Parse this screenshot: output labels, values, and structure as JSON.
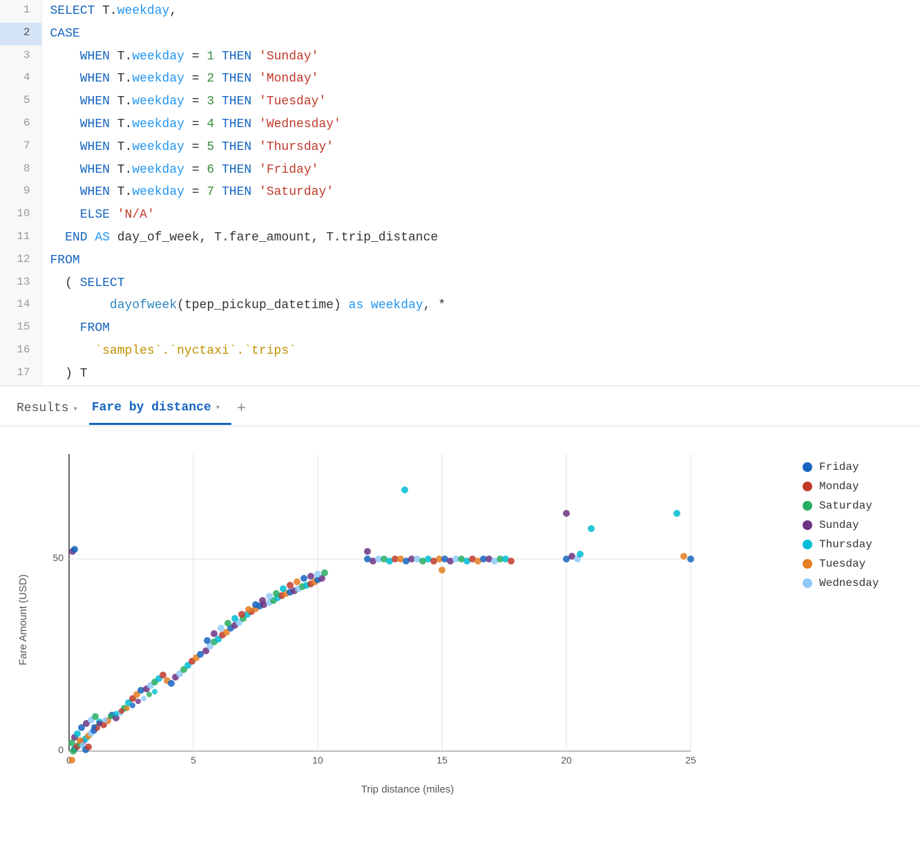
{
  "code": {
    "lines": [
      {
        "num": 1,
        "active": false,
        "content": [
          {
            "t": "kw",
            "v": "SELECT"
          },
          {
            "t": "plain",
            "v": " T."
          },
          {
            "t": "field",
            "v": "weekday"
          },
          {
            "t": "plain",
            "v": ","
          }
        ]
      },
      {
        "num": 2,
        "active": true,
        "content": [
          {
            "t": "kw",
            "v": "CASE"
          }
        ]
      },
      {
        "num": 3,
        "active": false,
        "content": [
          {
            "t": "plain",
            "v": "    "
          },
          {
            "t": "kw",
            "v": "WHEN"
          },
          {
            "t": "plain",
            "v": " T."
          },
          {
            "t": "field",
            "v": "weekday"
          },
          {
            "t": "plain",
            "v": " = "
          },
          {
            "t": "num",
            "v": "1"
          },
          {
            "t": "plain",
            "v": " "
          },
          {
            "t": "kw",
            "v": "THEN"
          },
          {
            "t": "plain",
            "v": " "
          },
          {
            "t": "str",
            "v": "'Sunday'"
          }
        ]
      },
      {
        "num": 4,
        "active": false,
        "content": [
          {
            "t": "plain",
            "v": "    "
          },
          {
            "t": "kw",
            "v": "WHEN"
          },
          {
            "t": "plain",
            "v": " T."
          },
          {
            "t": "field",
            "v": "weekday"
          },
          {
            "t": "plain",
            "v": " = "
          },
          {
            "t": "num",
            "v": "2"
          },
          {
            "t": "plain",
            "v": " "
          },
          {
            "t": "kw",
            "v": "THEN"
          },
          {
            "t": "plain",
            "v": " "
          },
          {
            "t": "str",
            "v": "'Monday'"
          }
        ]
      },
      {
        "num": 5,
        "active": false,
        "content": [
          {
            "t": "plain",
            "v": "    "
          },
          {
            "t": "kw",
            "v": "WHEN"
          },
          {
            "t": "plain",
            "v": " T."
          },
          {
            "t": "field",
            "v": "weekday"
          },
          {
            "t": "plain",
            "v": " = "
          },
          {
            "t": "num",
            "v": "3"
          },
          {
            "t": "plain",
            "v": " "
          },
          {
            "t": "kw",
            "v": "THEN"
          },
          {
            "t": "plain",
            "v": " "
          },
          {
            "t": "str",
            "v": "'Tuesday'"
          }
        ]
      },
      {
        "num": 6,
        "active": false,
        "content": [
          {
            "t": "plain",
            "v": "    "
          },
          {
            "t": "kw",
            "v": "WHEN"
          },
          {
            "t": "plain",
            "v": " T."
          },
          {
            "t": "field",
            "v": "weekday"
          },
          {
            "t": "plain",
            "v": " = "
          },
          {
            "t": "num",
            "v": "4"
          },
          {
            "t": "plain",
            "v": " "
          },
          {
            "t": "kw",
            "v": "THEN"
          },
          {
            "t": "plain",
            "v": " "
          },
          {
            "t": "str",
            "v": "'Wednesday'"
          }
        ]
      },
      {
        "num": 7,
        "active": false,
        "content": [
          {
            "t": "plain",
            "v": "    "
          },
          {
            "t": "kw",
            "v": "WHEN"
          },
          {
            "t": "plain",
            "v": " T."
          },
          {
            "t": "field",
            "v": "weekday"
          },
          {
            "t": "plain",
            "v": " = "
          },
          {
            "t": "num",
            "v": "5"
          },
          {
            "t": "plain",
            "v": " "
          },
          {
            "t": "kw",
            "v": "THEN"
          },
          {
            "t": "plain",
            "v": " "
          },
          {
            "t": "str",
            "v": "'Thursday'"
          }
        ]
      },
      {
        "num": 8,
        "active": false,
        "content": [
          {
            "t": "plain",
            "v": "    "
          },
          {
            "t": "kw",
            "v": "WHEN"
          },
          {
            "t": "plain",
            "v": " T."
          },
          {
            "t": "field",
            "v": "weekday"
          },
          {
            "t": "plain",
            "v": " = "
          },
          {
            "t": "num",
            "v": "6"
          },
          {
            "t": "plain",
            "v": " "
          },
          {
            "t": "kw",
            "v": "THEN"
          },
          {
            "t": "plain",
            "v": " "
          },
          {
            "t": "str",
            "v": "'Friday'"
          }
        ]
      },
      {
        "num": 9,
        "active": false,
        "content": [
          {
            "t": "plain",
            "v": "    "
          },
          {
            "t": "kw",
            "v": "WHEN"
          },
          {
            "t": "plain",
            "v": " T."
          },
          {
            "t": "field",
            "v": "weekday"
          },
          {
            "t": "plain",
            "v": " = "
          },
          {
            "t": "num",
            "v": "7"
          },
          {
            "t": "plain",
            "v": " "
          },
          {
            "t": "kw",
            "v": "THEN"
          },
          {
            "t": "plain",
            "v": " "
          },
          {
            "t": "str",
            "v": "'Saturday'"
          }
        ]
      },
      {
        "num": 10,
        "active": false,
        "content": [
          {
            "t": "plain",
            "v": "    "
          },
          {
            "t": "kw",
            "v": "ELSE"
          },
          {
            "t": "plain",
            "v": " "
          },
          {
            "t": "str",
            "v": "'N/A'"
          }
        ]
      },
      {
        "num": 11,
        "active": false,
        "content": [
          {
            "t": "plain",
            "v": "  "
          },
          {
            "t": "kw",
            "v": "END"
          },
          {
            "t": "plain",
            "v": " "
          },
          {
            "t": "as-kw",
            "v": "AS"
          },
          {
            "t": "plain",
            "v": " day_of_week, T.fare_amount, T.trip_distance"
          }
        ]
      },
      {
        "num": 12,
        "active": false,
        "content": [
          {
            "t": "kw",
            "v": "FROM"
          }
        ]
      },
      {
        "num": 13,
        "active": false,
        "content": [
          {
            "t": "plain",
            "v": "  ( "
          },
          {
            "t": "kw",
            "v": "SELECT"
          }
        ]
      },
      {
        "num": 14,
        "active": false,
        "content": [
          {
            "t": "plain",
            "v": "        "
          },
          {
            "t": "fn",
            "v": "dayofweek"
          },
          {
            "t": "plain",
            "v": "(tpep_pickup_datetime) "
          },
          {
            "t": "as-kw",
            "v": "as"
          },
          {
            "t": "plain",
            "v": " "
          },
          {
            "t": "field",
            "v": "weekday"
          },
          {
            "t": "plain",
            "v": ", *"
          }
        ]
      },
      {
        "num": 15,
        "active": false,
        "content": [
          {
            "t": "plain",
            "v": "    "
          },
          {
            "t": "kw",
            "v": "FROM"
          }
        ]
      },
      {
        "num": 16,
        "active": false,
        "content": [
          {
            "t": "plain",
            "v": "      "
          },
          {
            "t": "tick",
            "v": "`samples`.`nyctaxi`.`trips`"
          }
        ]
      },
      {
        "num": 17,
        "active": false,
        "content": [
          {
            "t": "plain",
            "v": "  ) T"
          }
        ]
      }
    ]
  },
  "tabs": {
    "results_label": "Results",
    "fare_by_distance_label": "Fare by distance",
    "add_label": "+"
  },
  "legend": {
    "items": [
      {
        "label": "Friday",
        "color": "#1565c0"
      },
      {
        "label": "Monday",
        "color": "#c0392b"
      },
      {
        "label": "Saturday",
        "color": "#27ae60"
      },
      {
        "label": "Sunday",
        "color": "#6c3483"
      },
      {
        "label": "Thursday",
        "color": "#00bcd4"
      },
      {
        "label": "Tuesday",
        "color": "#e67e22"
      },
      {
        "label": "Wednesday",
        "color": "#90caf9"
      }
    ]
  },
  "chart": {
    "x_axis_label": "Trip distance (miles)",
    "y_axis_label": "Fare Amount (USD)",
    "x_ticks": [
      "0",
      "5",
      "10",
      "15",
      "20",
      "25"
    ],
    "y_ticks": [
      "0",
      "50"
    ]
  }
}
